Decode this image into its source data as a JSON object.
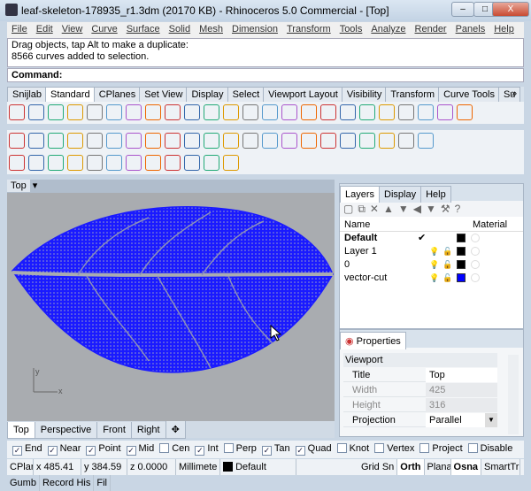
{
  "window": {
    "title": "leaf-skeleton-178935_r1.3dm (20170 KB) - Rhinoceros 5.0 Commercial - [Top]",
    "minimize": "–",
    "maximize": "□",
    "close": "X"
  },
  "menu": [
    "File",
    "Edit",
    "View",
    "Curve",
    "Surface",
    "Solid",
    "Mesh",
    "Dimension",
    "Transform",
    "Tools",
    "Analyze",
    "Render",
    "Panels",
    "Help"
  ],
  "history": [
    "Drag objects, tap Alt to make a duplicate:",
    "8566 curves added to selection."
  ],
  "command_label": "Command:",
  "toolbar_tabs": [
    "Snijlab",
    "Standard",
    "CPlanes",
    "Set View",
    "Display",
    "Select",
    "Viewport Layout",
    "Visibility",
    "Transform",
    "Curve Tools",
    "Su"
  ],
  "toolbar_tabs_active": "Standard",
  "toolbar_more": "»",
  "toolbar1_icons": [
    "new-icon",
    "open-icon",
    "save-icon",
    "print-icon",
    "import-icon",
    "cut-icon",
    "copy-icon",
    "paste-icon",
    "undo-icon",
    "pan-icon",
    "move-icon",
    "zoom-icon",
    "zoom-window-icon",
    "zoom-extents-icon",
    "zoom-selected-icon",
    "rotate-view-icon",
    "four-viewports-icon",
    "car-icon",
    "hide-icon",
    "lock-icon",
    "circle-icon",
    "cplane-icon",
    "light-icon",
    "options-icon"
  ],
  "toolbar2_icons": [
    "select-icon",
    "point-icon",
    "polyline-icon",
    "curve-icon",
    "circle-icon",
    "ellipse-icon",
    "arc-icon",
    "rectangle-icon",
    "polygon-icon",
    "fillet-icon",
    "edit-points-icon",
    "extrude-icon",
    "box-icon",
    "sphere-icon",
    "surface-icon",
    "boolean-icon",
    "gear-icon",
    "split-icon",
    "array-icon",
    "transform-icon",
    "mirror-icon",
    "scale-icon"
  ],
  "toolbar3_icons": [
    "text-icon",
    "group-icon",
    "explode-icon",
    "join-icon",
    "solid-icon",
    "dimension-icon",
    "hatch-icon",
    "grid-icon",
    "block-icon",
    "check-icon",
    "mesh-icon",
    "render-icon"
  ],
  "viewport": {
    "title": "Top",
    "tabs": [
      "Top",
      "Perspective",
      "Front",
      "Right"
    ],
    "active_tab": "Top",
    "add_tab": "✥",
    "axis_x": "x",
    "axis_y": "y",
    "curve_color": "#1a1aff",
    "background": "#a9acb0"
  },
  "layers_panel": {
    "tabs": [
      "Layers",
      "Display",
      "Help"
    ],
    "columns": {
      "name": "Name",
      "material": "Material"
    },
    "rows": [
      {
        "name": "Default",
        "current": true,
        "color": "#000000"
      },
      {
        "name": "Layer 1",
        "color": "#000000"
      },
      {
        "name": "0",
        "color": "#000000"
      },
      {
        "name": "vector-cut",
        "color": "#0000ff"
      }
    ],
    "check": "✔",
    "bulb": "💡",
    "lock": "🔓"
  },
  "properties_panel": {
    "tab": "Properties",
    "section": "Viewport",
    "rows": [
      {
        "key": "Title",
        "value": "Top"
      },
      {
        "key": "Width",
        "value": "425",
        "disabled": true
      },
      {
        "key": "Height",
        "value": "316",
        "disabled": true
      },
      {
        "key": "Projection",
        "value": "Parallel"
      }
    ]
  },
  "osnaps": [
    {
      "label": "End",
      "checked": true
    },
    {
      "label": "Near",
      "checked": true
    },
    {
      "label": "Point",
      "checked": true
    },
    {
      "label": "Mid",
      "checked": true
    },
    {
      "label": "Cen",
      "checked": false
    },
    {
      "label": "Int",
      "checked": true
    },
    {
      "label": "Perp",
      "checked": false
    },
    {
      "label": "Tan",
      "checked": true
    },
    {
      "label": "Quad",
      "checked": true
    },
    {
      "label": "Knot",
      "checked": false
    },
    {
      "label": "Vertex",
      "checked": false
    },
    {
      "label": "Project",
      "checked": false
    },
    {
      "label": "Disable",
      "checked": false
    }
  ],
  "status": {
    "cplane": "CPlar",
    "x": "x 485.41",
    "y": "y 384.59",
    "z": "z 0.0000",
    "units": "Millimete",
    "layer": "Default",
    "grid_snap": "Grid Sn",
    "ortho": "Orth",
    "planar": "Plana",
    "osnap": "Osna",
    "smarttrack": "SmartTr",
    "gumball": "Gumb",
    "record_history": "Record His",
    "filter": "Fil"
  }
}
